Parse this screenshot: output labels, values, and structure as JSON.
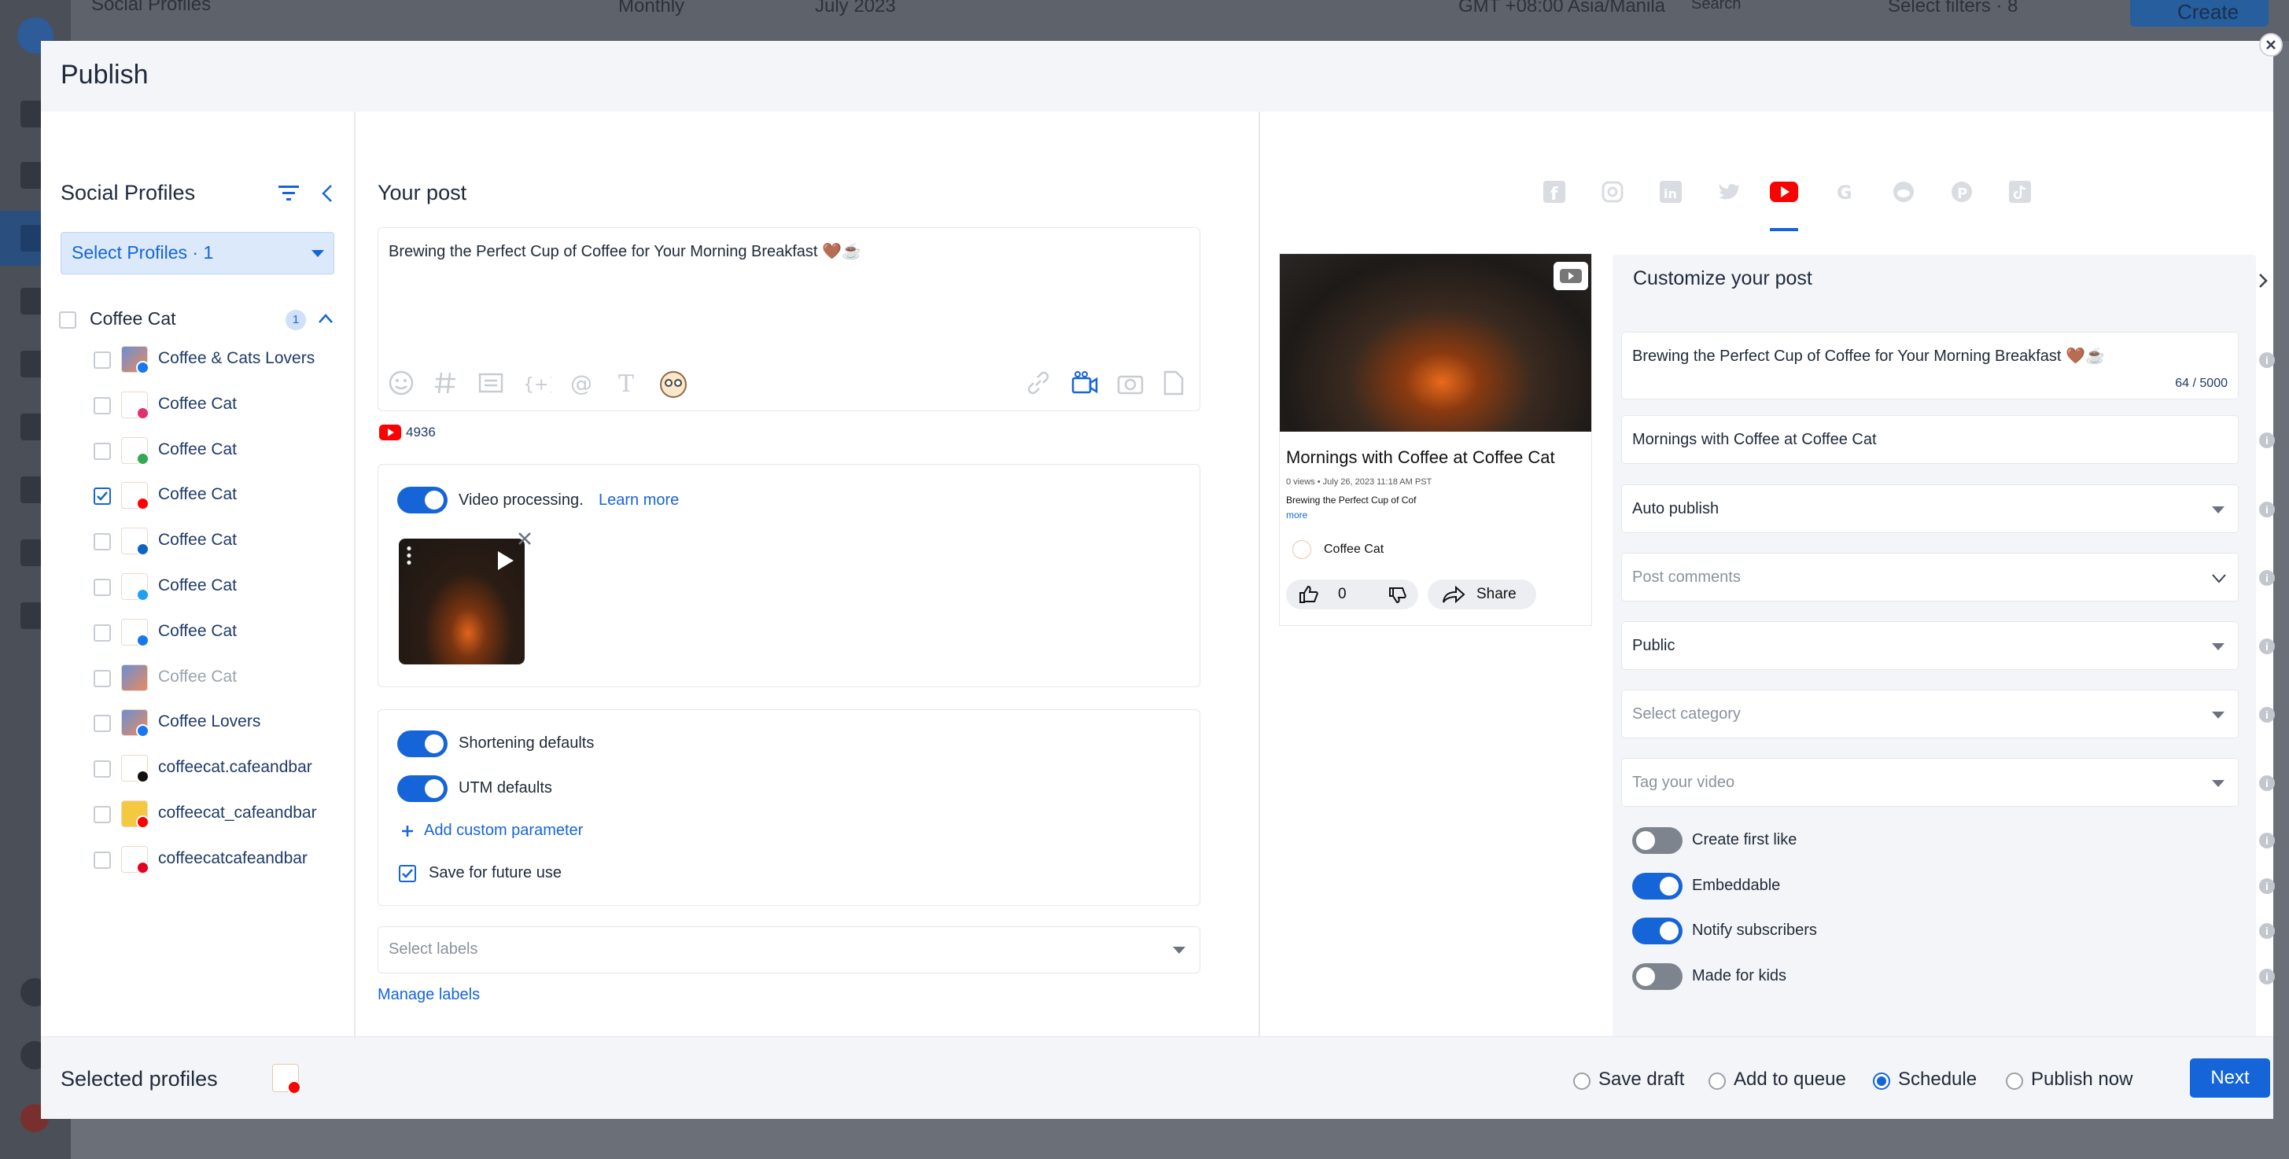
{
  "background": {
    "app_title": "Social Profiles",
    "view_mode": "Monthly",
    "period": "July 2023",
    "timezone": "GMT +08:00 Asia/Manila",
    "search_placeholder": "Search",
    "filters_label": "Select filters · 8",
    "create_label": "Create"
  },
  "modal": {
    "title": "Publish"
  },
  "profiles_panel": {
    "title": "Social Profiles",
    "select_label": "Select Profiles · 1",
    "group": {
      "name": "Coffee Cat",
      "count": "1"
    },
    "items": [
      {
        "label": "Coffee & Cats Lovers",
        "network": "facebook",
        "checked": false,
        "dim": false
      },
      {
        "label": "Coffee Cat",
        "network": "instagram",
        "checked": false,
        "dim": false
      },
      {
        "label": "Coffee Cat",
        "network": "google",
        "checked": false,
        "dim": false
      },
      {
        "label": "Coffee Cat",
        "network": "youtube",
        "checked": true,
        "dim": false
      },
      {
        "label": "Coffee Cat",
        "network": "linkedin",
        "checked": false,
        "dim": false
      },
      {
        "label": "Coffee Cat",
        "network": "twitter",
        "checked": false,
        "dim": false
      },
      {
        "label": "Coffee Cat",
        "network": "facebook",
        "checked": false,
        "dim": false
      },
      {
        "label": "Coffee Cat",
        "network": "none",
        "checked": false,
        "dim": true
      },
      {
        "label": "Coffee Lovers",
        "network": "facebook",
        "checked": false,
        "dim": false
      },
      {
        "label": "coffeecat.cafeandbar",
        "network": "tiktok",
        "checked": false,
        "dim": false
      },
      {
        "label": "coffeecat_cafeandbar",
        "network": "youtube",
        "checked": false,
        "dim": false
      },
      {
        "label": "coffeecatcafeandbar",
        "network": "pinterest",
        "checked": false,
        "dim": false
      }
    ]
  },
  "post": {
    "title": "Your post",
    "text": "Brewing the Perfect Cup of Coffee for Your Morning Breakfast 🤎☕",
    "char_remaining": "4936",
    "video_processing_label": "Video processing.",
    "learn_more": "Learn more",
    "shortening_label": "Shortening defaults",
    "utm_label": "UTM defaults",
    "add_param": "Add custom parameter",
    "save_future": "Save for future use",
    "labels_placeholder": "Select labels",
    "manage_labels": "Manage labels"
  },
  "preview": {
    "video_title": "Mornings with Coffee at Coffee Cat",
    "meta": "0 views • July 26, 2023 11:18 AM PST",
    "desc": "Brewing the Perfect Cup of Cof",
    "more": "more",
    "channel": "Coffee Cat",
    "likes": "0",
    "share": "Share"
  },
  "customize": {
    "title": "Customize your post",
    "description": "Brewing the Perfect Cup of Coffee for Your Morning Breakfast 🤎☕",
    "char_count": "64 / 5000",
    "video_title": "Mornings with Coffee at Coffee Cat",
    "publish_mode": "Auto publish",
    "comments_placeholder": "Post comments",
    "visibility": "Public",
    "category_placeholder": "Select category",
    "tags_placeholder": "Tag your video",
    "toggles": [
      {
        "label": "Create first like",
        "on": false
      },
      {
        "label": "Embeddable",
        "on": true
      },
      {
        "label": "Notify subscribers",
        "on": true
      },
      {
        "label": "Made for kids",
        "on": false
      }
    ]
  },
  "footer": {
    "selected_label": "Selected profiles",
    "options": [
      "Save draft",
      "Add to queue",
      "Schedule",
      "Publish now"
    ],
    "selected_option": "Schedule",
    "next": "Next"
  },
  "colors": {
    "accent": "#1565d8",
    "youtube": "#ff0000",
    "panel_bg": "#f4f5f8"
  }
}
